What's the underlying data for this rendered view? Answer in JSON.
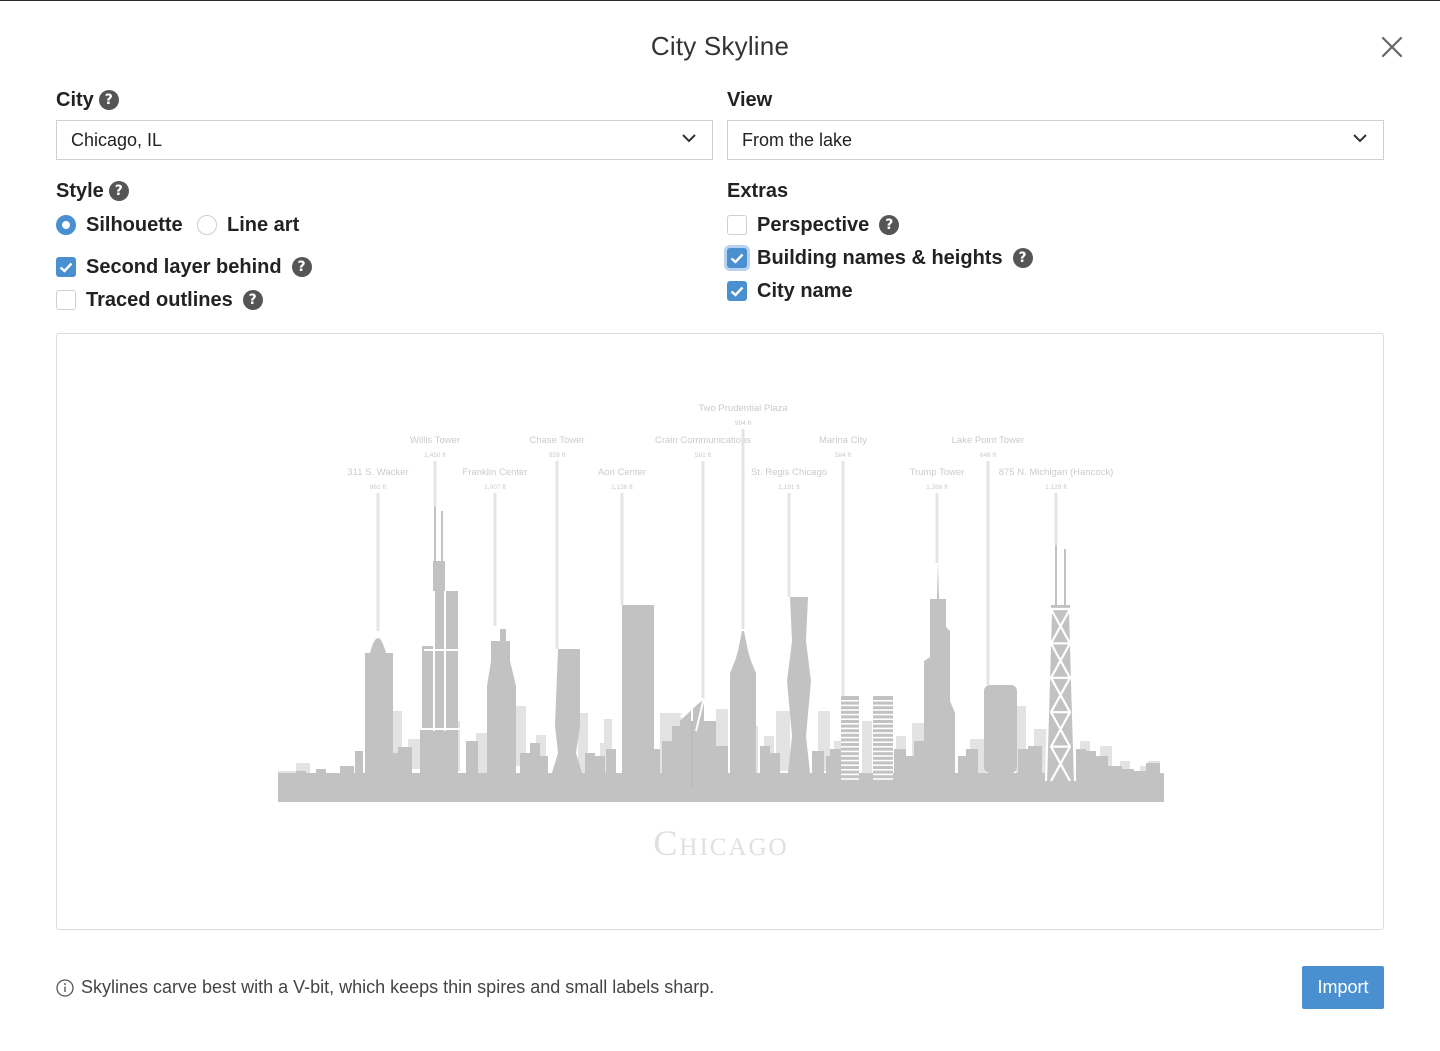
{
  "dialog": {
    "title": "City Skyline",
    "close_icon": "close-icon"
  },
  "city": {
    "label": "City",
    "value": "Chicago, IL"
  },
  "view": {
    "label": "View",
    "value": "From the lake"
  },
  "style": {
    "label": "Style",
    "options": [
      {
        "label": "Silhouette",
        "selected": true
      },
      {
        "label": "Line art",
        "selected": false
      }
    ],
    "checkboxes": [
      {
        "label": "Second layer behind",
        "checked": true
      },
      {
        "label": "Traced outlines",
        "checked": false
      }
    ]
  },
  "extras": {
    "label": "Extras",
    "checkboxes": [
      {
        "label": "Perspective",
        "checked": false
      },
      {
        "label": "Building names & heights",
        "checked": true
      },
      {
        "label": "City name",
        "checked": true
      }
    ]
  },
  "preview": {
    "city_caption": "Chicago",
    "buildings": [
      {
        "name": "311 S. Wacker",
        "height": "961 ft"
      },
      {
        "name": "Willis Tower",
        "height": "1,450 ft"
      },
      {
        "name": "Franklin Center",
        "height": "1,007 ft"
      },
      {
        "name": "Chase Tower",
        "height": "859 ft"
      },
      {
        "name": "Aon Center",
        "height": "1,136 ft"
      },
      {
        "name": "Crain Communications",
        "height": "581 ft"
      },
      {
        "name": "Two Prudential Plaza",
        "height": "994 ft"
      },
      {
        "name": "St. Regis Chicago",
        "height": "1,191 ft"
      },
      {
        "name": "Marina City",
        "height": "584 ft"
      },
      {
        "name": "Trump Tower",
        "height": "1,388 ft"
      },
      {
        "name": "Lake Point Tower",
        "height": "646 ft"
      },
      {
        "name": "875 N. Michigan (Hancock)",
        "height": "1,129 ft"
      }
    ],
    "colors": {
      "front": "#c2c2c2",
      "back": "#e3e3e3",
      "label": "#cbcbcb"
    }
  },
  "footer": {
    "note": "Skylines carve best with a V-bit, which keeps thin spires and small labels sharp.",
    "info_icon": "info-icon",
    "import_label": "Import"
  },
  "colors": {
    "accent": "#4a90d0",
    "help_icon_bg": "#555555"
  }
}
